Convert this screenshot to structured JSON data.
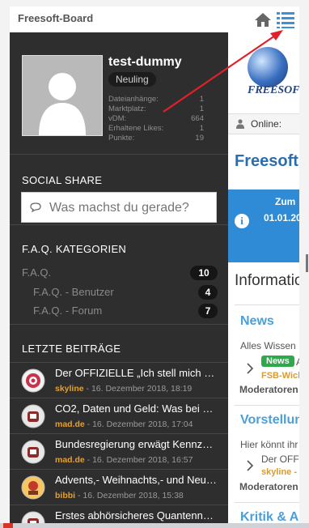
{
  "header": {
    "title": "Freesoft-Board"
  },
  "profile": {
    "username": "test-dummy",
    "rank": "Neuling",
    "stats": [
      {
        "label": "Dateianhänge:",
        "value": "1"
      },
      {
        "label": "Marktplatz:",
        "value": "1"
      },
      {
        "label": "vDM:",
        "value": "664"
      },
      {
        "label": "Erhaltene Likes:",
        "value": "1"
      },
      {
        "label": "Punkte:",
        "value": "19"
      }
    ]
  },
  "social": {
    "title": "SOCIAL SHARE",
    "placeholder": "Was machst du gerade?"
  },
  "faq": {
    "title": "F.A.Q. KATEGORIEN",
    "items": [
      {
        "label": "F.A.Q.",
        "count": "10"
      },
      {
        "label": "F.A.Q. - Benutzer",
        "count": "4"
      },
      {
        "label": "F.A.Q. - Forum",
        "count": "7"
      }
    ]
  },
  "posts": {
    "title": "LETZTE BEITRÄGE",
    "items": [
      {
        "title": "Der OFFIZIELLE „Ich stell mich vor",
        "author": "skyline",
        "date": " - 16. Dezember 2018, 18:19"
      },
      {
        "title": "CO2, Daten und Geld: Was bei der",
        "author": "mad.de",
        "date": " - 16. Dezember 2018, 17:04"
      },
      {
        "title": "Bundesregierung erwägt Kennzeichen",
        "author": "mad.de",
        "date": " - 16. Dezember 2018, 16:57"
      },
      {
        "title": "Advents,- Weihnachts,- und Neujahrs",
        "author": "bibbi",
        "date": " - 16. Dezember 2018, 15:38"
      },
      {
        "title": "Erstes abhörsicheres Quantennetz",
        "author": "",
        "date": ""
      }
    ]
  },
  "main": {
    "logo_text": "FREESOFT",
    "online_label": "Online:",
    "headline": "Freesoft",
    "info_line1": "Zum",
    "info_line2": "01.01.20",
    "info_heading": "Informatio",
    "news_title": "News",
    "news_text": "Alles Wissen",
    "news_badge": "News",
    "news_badge_after": "A",
    "news_author": "FSB-Wich",
    "news_mod": "Moderatoren",
    "vorstellung_title": "Vorstellun",
    "vorstellung_text": "Hier könnt ihr",
    "vorstellung_post": "Der OFF",
    "vorstellung_author": "skyline -",
    "vorstellung_mod": "Moderatoren",
    "kritik_title": "Kritik & An"
  },
  "colors": {
    "sidebar": "#2e2e2e",
    "accent": "#2a6db0",
    "highlight_arrow": "#e0202a",
    "author": "#e1a03a"
  }
}
